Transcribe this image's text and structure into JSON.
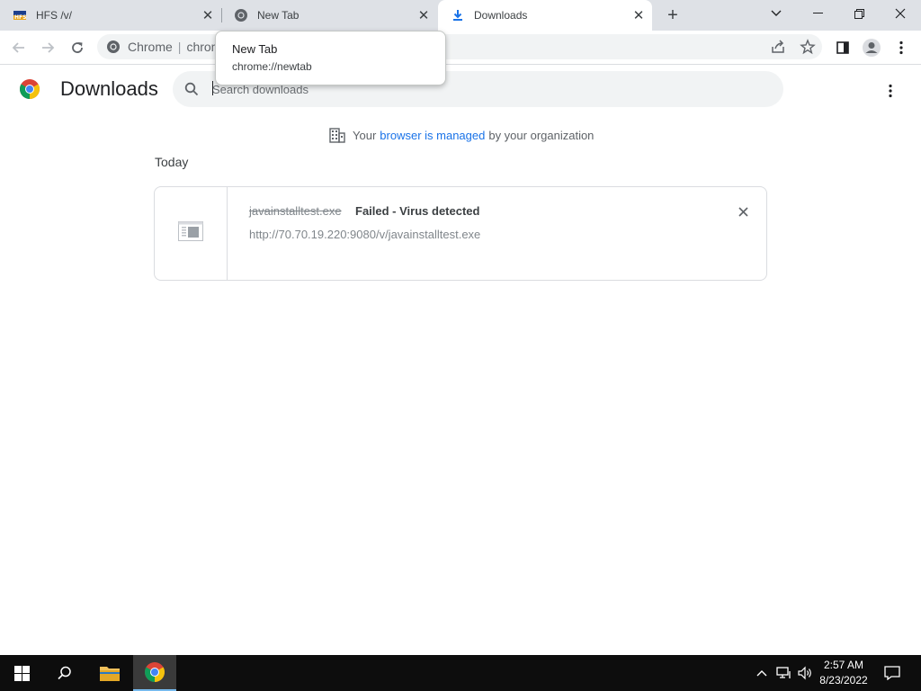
{
  "tabs": [
    {
      "title": "HFS /v/",
      "icon": "hfs-icon"
    },
    {
      "title": "New Tab",
      "icon": "chrome-icon"
    },
    {
      "title": "Downloads",
      "icon": "download-icon"
    }
  ],
  "omnibox": {
    "site_label": "Chrome",
    "url_partial": "chrom"
  },
  "tooltip": {
    "title": "New Tab",
    "url": "chrome://newtab"
  },
  "page": {
    "title": "Downloads",
    "search_placeholder": "Search downloads",
    "managed_prefix": "Your",
    "managed_link": "browser is managed",
    "managed_suffix": "by your organization",
    "section_label": "Today"
  },
  "download": {
    "filename": "javainstalltest.exe",
    "status": "Failed - Virus detected",
    "url": "http://70.70.19.220:9080/v/javainstalltest.exe"
  },
  "taskbar": {
    "time": "2:57 AM",
    "date": "8/23/2022"
  },
  "colors": {
    "accent": "#1a73e8",
    "tabstrip": "#dee1e6",
    "taskbar": "#0d0d0d"
  }
}
